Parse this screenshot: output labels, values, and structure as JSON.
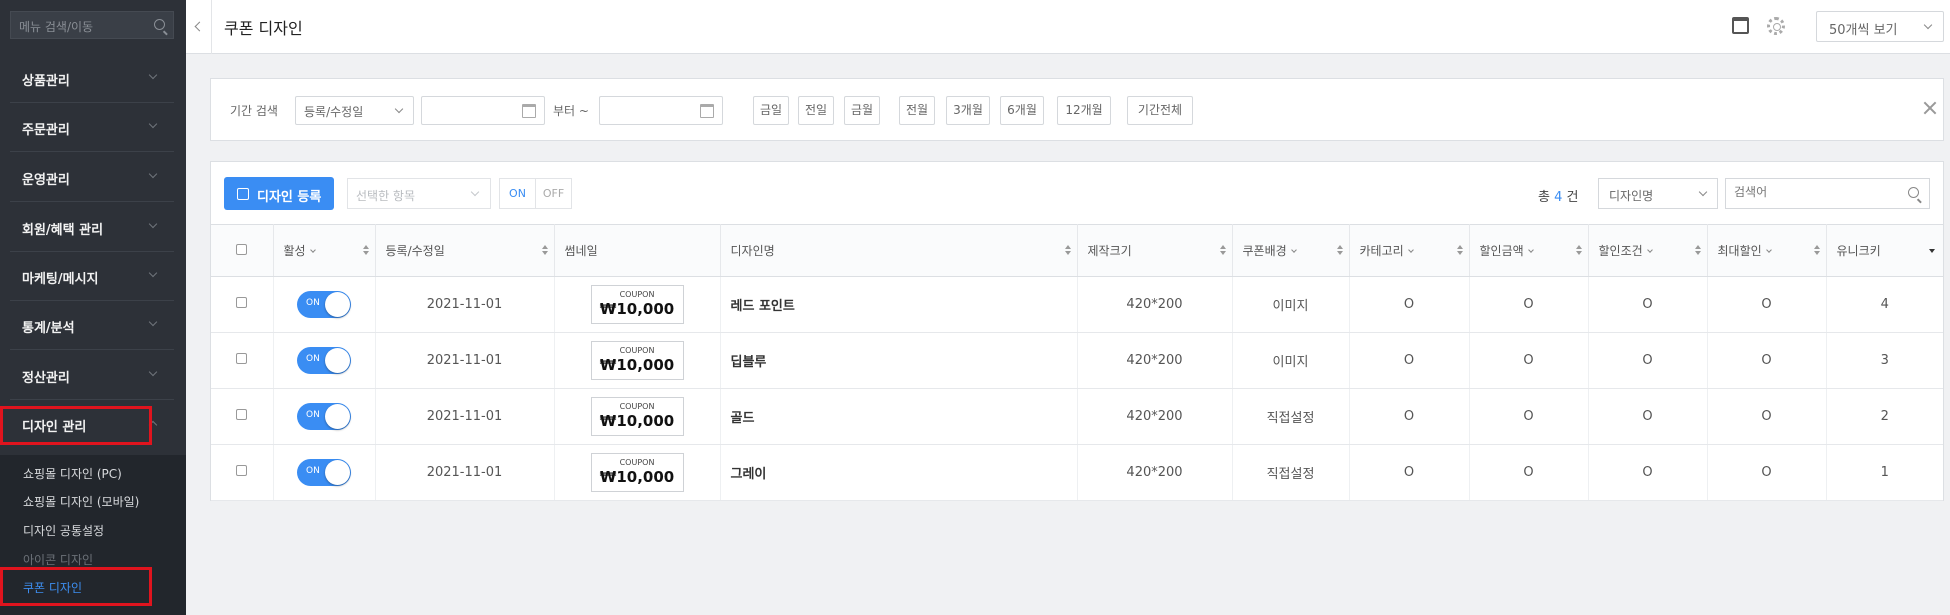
{
  "sidebar": {
    "search_placeholder": "메뉴 검색/이동",
    "menus": [
      "상품관리",
      "주문관리",
      "운영관리",
      "회원/혜택 관리",
      "마케팅/메시지",
      "통계/분석",
      "정산관리",
      "디자인 관리"
    ],
    "submenu": [
      "쇼핑몰 디자인 (PC)",
      "쇼핑몰 디자인 (모바일)",
      "디자인 공통설정",
      "아이콘 디자인",
      "쿠폰 디자인"
    ]
  },
  "header": {
    "title": "쿠폰 디자인",
    "view_count": "50개씩 보기"
  },
  "filter": {
    "period_label": "기간 검색",
    "period_type": "등록/수정일",
    "from_label": "부터 ~",
    "buttons": [
      "금일",
      "전일",
      "금월",
      "전월",
      "3개월",
      "6개월",
      "12개월",
      "기간전체"
    ]
  },
  "toolbar": {
    "register_label": "디자인 등록",
    "selected_items": "선택한 항목",
    "on": "ON",
    "off": "OFF",
    "total_prefix": "총",
    "total_count": "4",
    "total_suffix": "건",
    "search_field": "디자인명",
    "search_placeholder": "검색어"
  },
  "table": {
    "headers": {
      "active": "활성",
      "date": "등록/수정일",
      "thumb": "썸네일",
      "name": "디자인명",
      "size": "제작크기",
      "bg": "쿠폰배경",
      "category": "카테고리",
      "discount": "할인금액",
      "condition": "할인조건",
      "max": "최대할인",
      "key": "유니크키"
    },
    "rows": [
      {
        "active": "ON",
        "date": "2021-11-01",
        "coupon_word": "COUPON",
        "coupon_amount": "₩10,000",
        "name": "레드 포인트",
        "size": "420*200",
        "bg": "이미지",
        "category": "O",
        "discount": "O",
        "condition": "O",
        "max": "O",
        "key": "4"
      },
      {
        "active": "ON",
        "date": "2021-11-01",
        "coupon_word": "COUPON",
        "coupon_amount": "₩10,000",
        "name": "딥블루",
        "size": "420*200",
        "bg": "이미지",
        "category": "O",
        "discount": "O",
        "condition": "O",
        "max": "O",
        "key": "3"
      },
      {
        "active": "ON",
        "date": "2021-11-01",
        "coupon_word": "COUPON",
        "coupon_amount": "₩10,000",
        "name": "골드",
        "size": "420*200",
        "bg": "직접설정",
        "category": "O",
        "discount": "O",
        "condition": "O",
        "max": "O",
        "key": "2"
      },
      {
        "active": "ON",
        "date": "2021-11-01",
        "coupon_word": "COUPON",
        "coupon_amount": "₩10,000",
        "name": "그레이",
        "size": "420*200",
        "bg": "직접설정",
        "category": "O",
        "discount": "O",
        "condition": "O",
        "max": "O",
        "key": "1"
      }
    ]
  },
  "colors": {
    "accent": "#3a8df3",
    "sidebar_bg": "#2d3138",
    "highlight": "#e0141e"
  }
}
